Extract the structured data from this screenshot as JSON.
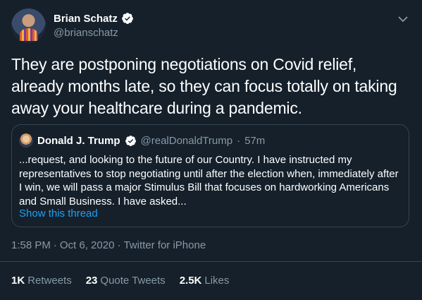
{
  "author": {
    "name": "Brian Schatz",
    "handle": "@brianschatz"
  },
  "tweet_text": "They are postponing negotiations on Covid relief, already months late, so they can focus totally on taking away your healthcare during a pandemic.",
  "quoted_tweet": {
    "name": "Donald J. Trump",
    "handle": "@realDonaldTrump",
    "separator": "·",
    "time": "57m",
    "text": "...request, and looking to the future of our Country. I have instructed my representatives to stop negotiating until after the election when, immediately after I win, we will pass a major Stimulus Bill that focuses on hardworking Americans and Small Business. I have asked...",
    "show_thread_label": "Show this thread"
  },
  "meta": {
    "time": "1:58 PM",
    "dot1": "·",
    "date": "Oct 6, 2020",
    "dot2": "·",
    "source": "Twitter for iPhone"
  },
  "stats": {
    "retweets_count": "1K",
    "retweets_label": "Retweets",
    "quote_count": "23",
    "quote_label": "Quote Tweets",
    "likes_count": "2.5K",
    "likes_label": "Likes"
  },
  "colors": {
    "background": "#15202b",
    "secondary_text": "#8899a6",
    "accent": "#1da1f2",
    "border": "#38444d"
  },
  "icons": {
    "verified": "verified-badge-icon",
    "more": "chevron-down-icon"
  }
}
